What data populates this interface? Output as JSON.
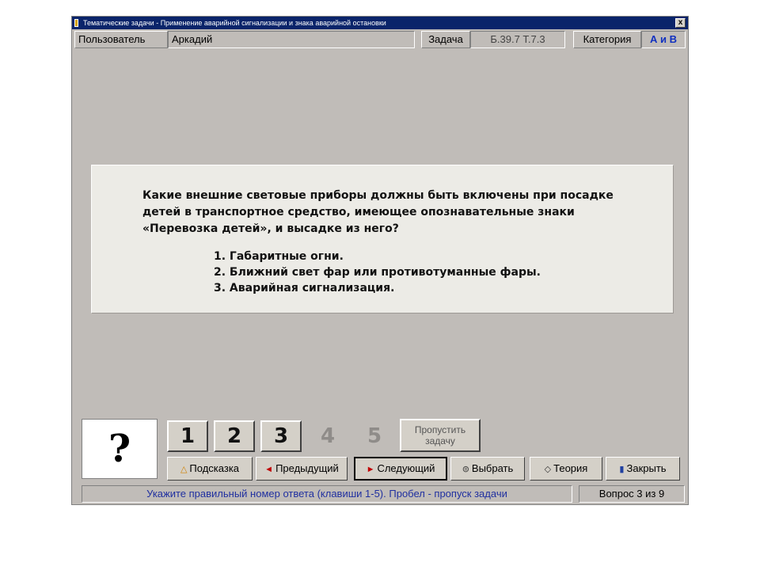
{
  "window": {
    "title": "Тематические задачи - Применение аварийной сигнализации и знака аварийной остановки",
    "close_label": "x"
  },
  "infobar": {
    "user_label": "Пользователь",
    "user_value": "Аркадий",
    "task_label": "Задача",
    "task_value": "Б.39.7  Т.7.3",
    "category_label": "Категория",
    "category_value": "А и В",
    "category_color": "#1030c0"
  },
  "question": {
    "text": "Какие внешние световые приборы должны быть включены при посадке детей в транспортное средство, имеющее опознавательные знаки «Перевозка детей», и высадке из него?",
    "answers": [
      "1. Габаритные огни.",
      "2. Ближний свет фар или противотуманные фары.",
      "3. Аварийная сигнализация."
    ]
  },
  "answer_indicator": "?",
  "number_buttons": [
    {
      "label": "1",
      "enabled": true
    },
    {
      "label": "2",
      "enabled": true
    },
    {
      "label": "3",
      "enabled": true
    },
    {
      "label": "4",
      "enabled": false
    },
    {
      "label": "5",
      "enabled": false
    }
  ],
  "skip_button": {
    "line1": "Пропустить",
    "line2": "задачу"
  },
  "actions": [
    {
      "label": "Подсказка",
      "icon": "bell-icon",
      "glyph": "△"
    },
    {
      "label": "Предыдущий",
      "icon": "arrow-left-icon",
      "glyph": "◄"
    },
    {
      "label": "Следующий",
      "icon": "arrow-right-icon",
      "glyph": "►"
    },
    {
      "label": "Выбрать",
      "icon": "list-icon",
      "glyph": "⊜"
    },
    {
      "label": "Теория",
      "icon": "book-icon",
      "glyph": "◇"
    },
    {
      "label": "Закрыть",
      "icon": "door-icon",
      "glyph": "▮"
    }
  ],
  "status": {
    "hint": "Укажите правильный номер ответа (клавиши 1-5). Пробел - пропуск задачи",
    "hint_color": "#2030a0",
    "progress": "Вопрос 3 из 9"
  }
}
